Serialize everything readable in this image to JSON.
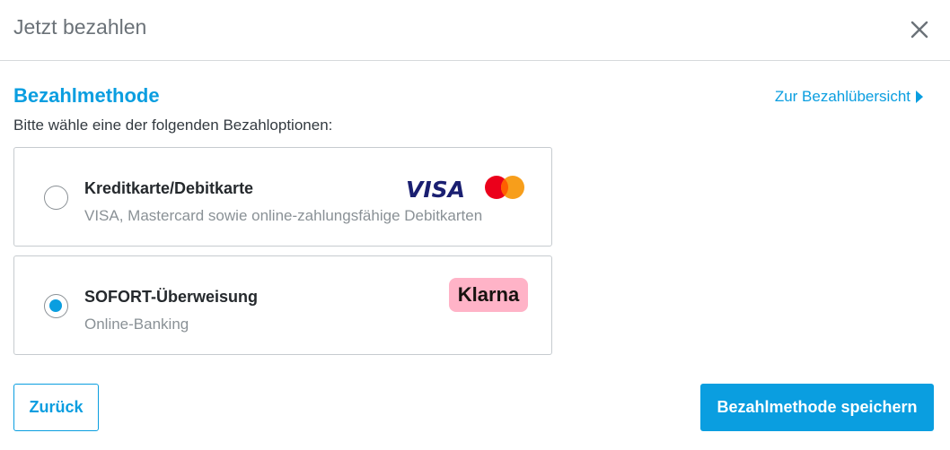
{
  "modal": {
    "title": "Jetzt bezahlen"
  },
  "section": {
    "title": "Bezahlmethode",
    "overview_link": "Zur Bezahlübersicht",
    "instruction": "Bitte wähle eine der folgenden Bezahloptionen:"
  },
  "options": [
    {
      "title": "Kreditkarte/Debitkarte",
      "subtitle": "VISA, Mastercard sowie online-zahlungsfähige Debitkarten",
      "selected": false,
      "logos": [
        "VISA",
        "mastercard-logo"
      ]
    },
    {
      "title": "SOFORT-Überweisung",
      "subtitle": "Online-Banking",
      "selected": true,
      "logos": [
        "Klarna"
      ]
    }
  ],
  "logos": {
    "visa": "VISA",
    "klarna": "Klarna"
  },
  "footer": {
    "back_label": "Zurück",
    "save_label": "Bezahlmethode speichern"
  },
  "colors": {
    "accent": "#0a9ee0",
    "klarna_pink": "#ffb3c7",
    "mastercard_red": "#eb001b",
    "mastercard_orange": "#f79e1b",
    "visa_blue": "#1a1f71"
  }
}
